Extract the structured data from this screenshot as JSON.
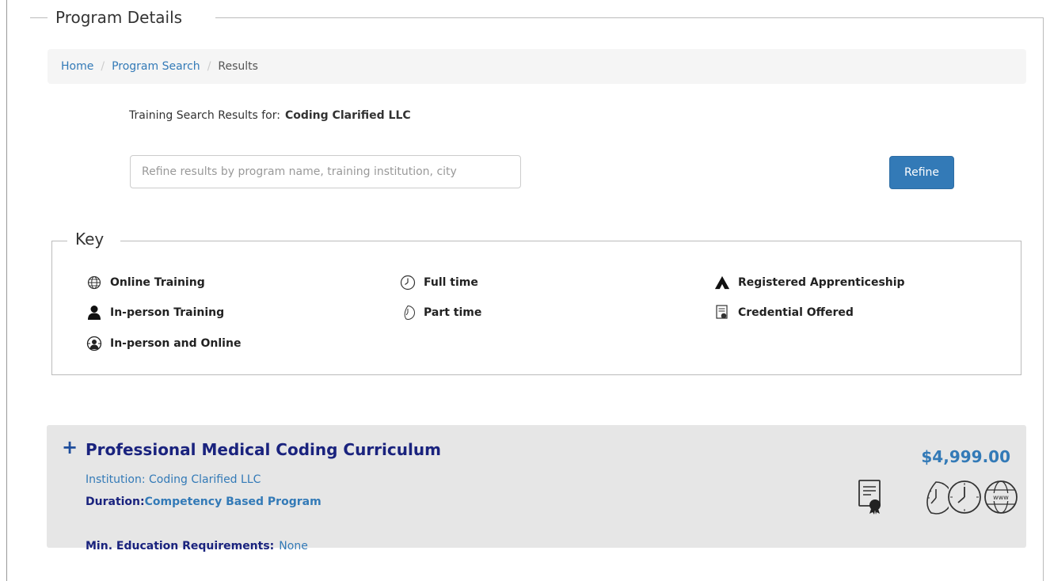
{
  "page": {
    "section_title": "Program Details"
  },
  "breadcrumb": {
    "items": [
      "Home",
      "Program Search"
    ],
    "current": "Results"
  },
  "search": {
    "results_label": "Training Search Results for:",
    "results_org": "Coding Clarified LLC",
    "placeholder": "Refine results by program name, training institution, city",
    "value": "",
    "button_label": "Refine"
  },
  "key": {
    "title": "Key",
    "items": [
      {
        "label": "Online Training",
        "icon": "globe-icon"
      },
      {
        "label": "In-person Training",
        "icon": "person-icon"
      },
      {
        "label": "In-person and Online",
        "icon": "person-globe-icon"
      },
      {
        "label": "Full time",
        "icon": "clock-icon"
      },
      {
        "label": "Part time",
        "icon": "half-clock-icon"
      },
      {
        "label": "Registered Apprenticeship",
        "icon": "apprenticeship-icon"
      },
      {
        "label": "Credential Offered",
        "icon": "certificate-icon"
      }
    ]
  },
  "program": {
    "title": "Professional Medical Coding Curriculum",
    "price": "$4,999.00",
    "institution_label": "Institution:",
    "institution_value": "Coding Clarified LLC",
    "duration_label": "Duration:",
    "duration_value": "Competency Based Program",
    "education_label": "Min. Education Requirements:",
    "education_value": "None",
    "icons": [
      "certificate-icon",
      "half-clock-icon",
      "clock-icon",
      "www-globe-icon"
    ]
  },
  "colors": {
    "link": "#337ab7",
    "title": "#1a237e",
    "card_bg": "#e6e6e6",
    "breadcrumb_bg": "#f5f5f5"
  }
}
